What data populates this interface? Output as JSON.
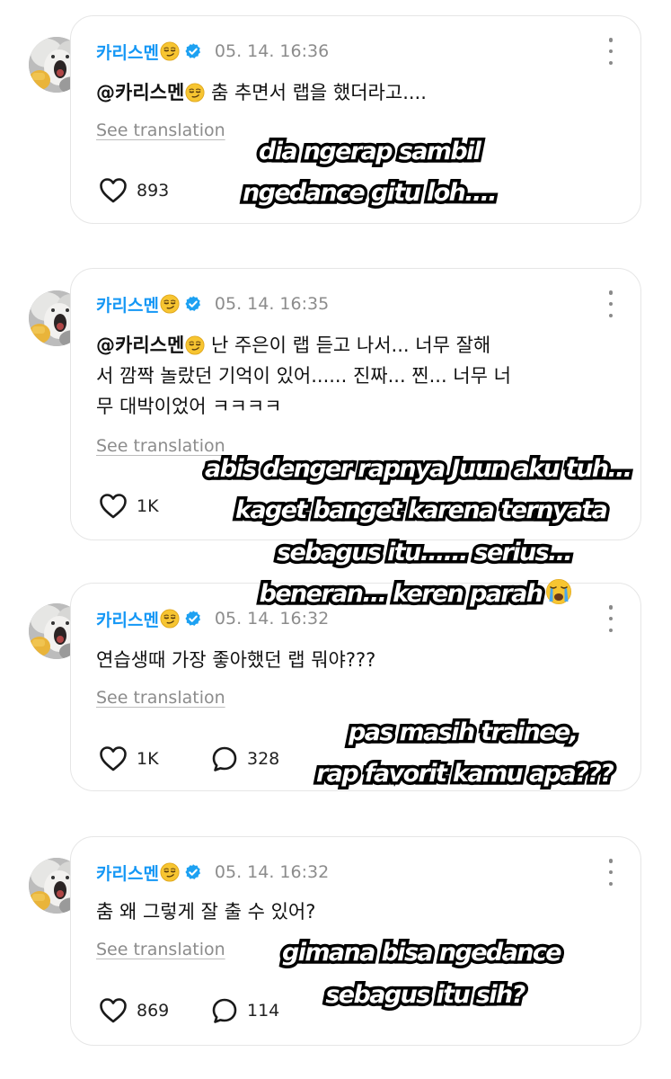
{
  "comments": [
    {
      "username": "카리스멘",
      "timestamp": "05. 14. 16:36",
      "mention": "@카리스멘",
      "text": "춤 추면서 랩을 했더라고....",
      "see_translation": "See translation",
      "likes": "893",
      "replies": ""
    },
    {
      "username": "카리스멘",
      "timestamp": "05. 14. 16:35",
      "mention": "@카리스멘",
      "text_line1": "난 주은이 랩 듣고 나서... 너무 잘해",
      "text_line2": "서 깜짝 놀랐던 기억이 있어...... 진짜... 찐... 너무 너",
      "text_line3": "무 대박이었어 ㅋㅋㅋㅋ",
      "see_translation": "See translation",
      "likes": "1K",
      "replies": ""
    },
    {
      "username": "카리스멘",
      "timestamp": "05. 14. 16:32",
      "mention": "",
      "text": "연습생때 가장 좋아했던 랩 뭐야???",
      "see_translation": "See translation",
      "likes": "1K",
      "replies": "328"
    },
    {
      "username": "카리스멘",
      "timestamp": "05. 14. 16:32",
      "mention": "",
      "text": "춤 왜 그렇게 잘 출 수 있어?",
      "see_translation": "See translation",
      "likes": "869",
      "replies": "114"
    }
  ],
  "captions": {
    "c1_line1": "dia ngerap sambil",
    "c1_line2": "ngedance gitu loh....",
    "c2_line1": "abis denger rapnya Juun aku tuh...",
    "c2_line2": "kaget banget karena ternyata",
    "c2_line3": "sebagus itu...... serius...",
    "c2_line4": "beneran... keren parah",
    "c3_line1": "pas masih trainee,",
    "c3_line2": "rap favorit kamu apa???",
    "c4_line1": "gimana bisa ngedance",
    "c4_line2": "sebagus itu sih?"
  },
  "icons": {
    "username_emoji": "smirking-face-emoji",
    "verified": "verified-badge-icon",
    "like": "heart-icon",
    "reply": "reply-bubble-icon",
    "more": "kebab-menu-icon",
    "caption_emoji": "loudly-crying-face-emoji"
  },
  "colors": {
    "username": "#1497f5",
    "verified": "#1da1f2",
    "meta": "#8c8c8c",
    "card_border": "#e6e6e6"
  }
}
